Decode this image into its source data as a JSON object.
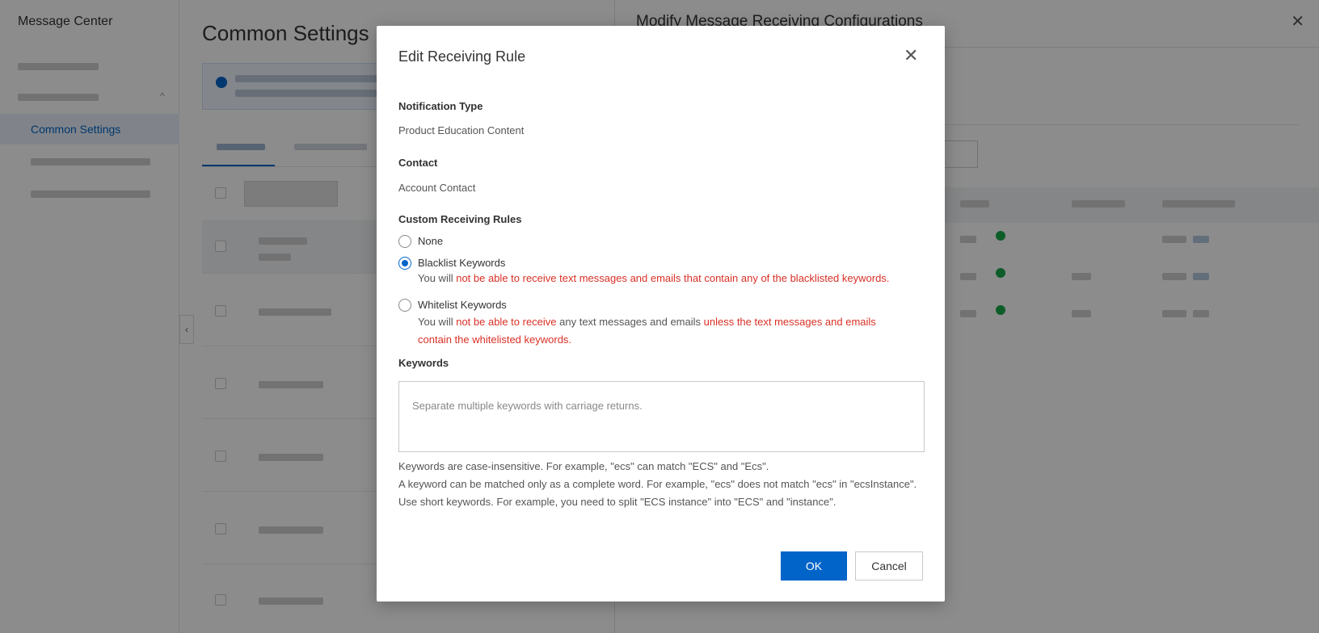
{
  "background": {
    "sidebar_title": "Message Center",
    "sidebar_active": "Common Settings",
    "page_title": "Common Settings",
    "drawer_title": "Modify Message Receiving Configurations",
    "drawer_close": "✕",
    "collapse_glyph": "‹"
  },
  "dialog": {
    "title": "Edit Receiving Rule",
    "close_glyph": "✕",
    "notification_type_label": "Notification Type",
    "notification_type_value": "Product Education Content",
    "contact_label": "Contact",
    "contact_value": "Account Contact",
    "rules_label": "Custom Receiving Rules",
    "options": [
      {
        "label": "None",
        "checked": false
      },
      {
        "label": "Blacklist Keywords",
        "checked": true
      },
      {
        "label": "Whitelist Keywords",
        "checked": false
      }
    ],
    "blacklist_hint": {
      "prefix": "You will ",
      "red": "not be able to receive text messages and emails that contain any of the blacklisted keywords."
    },
    "whitelist_hint": {
      "prefix": "You will ",
      "red1": "not be able to receive",
      "middle": " any text messages and emails ",
      "red2": "unless the text messages and emails contain the whitelisted keywords."
    },
    "keywords_label": "Keywords",
    "keywords_placeholder": "Separate multiple keywords with carriage returns.",
    "notes": [
      "Keywords are case-insensitive. For example, \"ecs\" can match \"ECS\" and \"Ecs\".",
      "A keyword can be matched only as a complete word. For example, \"ecs\" does not match \"ecs\" in \"ecsInstance\".",
      "Use short keywords. For example, you need to split \"ECS instance\" into \"ECS\" and \"instance\"."
    ],
    "ok_label": "OK",
    "cancel_label": "Cancel"
  }
}
